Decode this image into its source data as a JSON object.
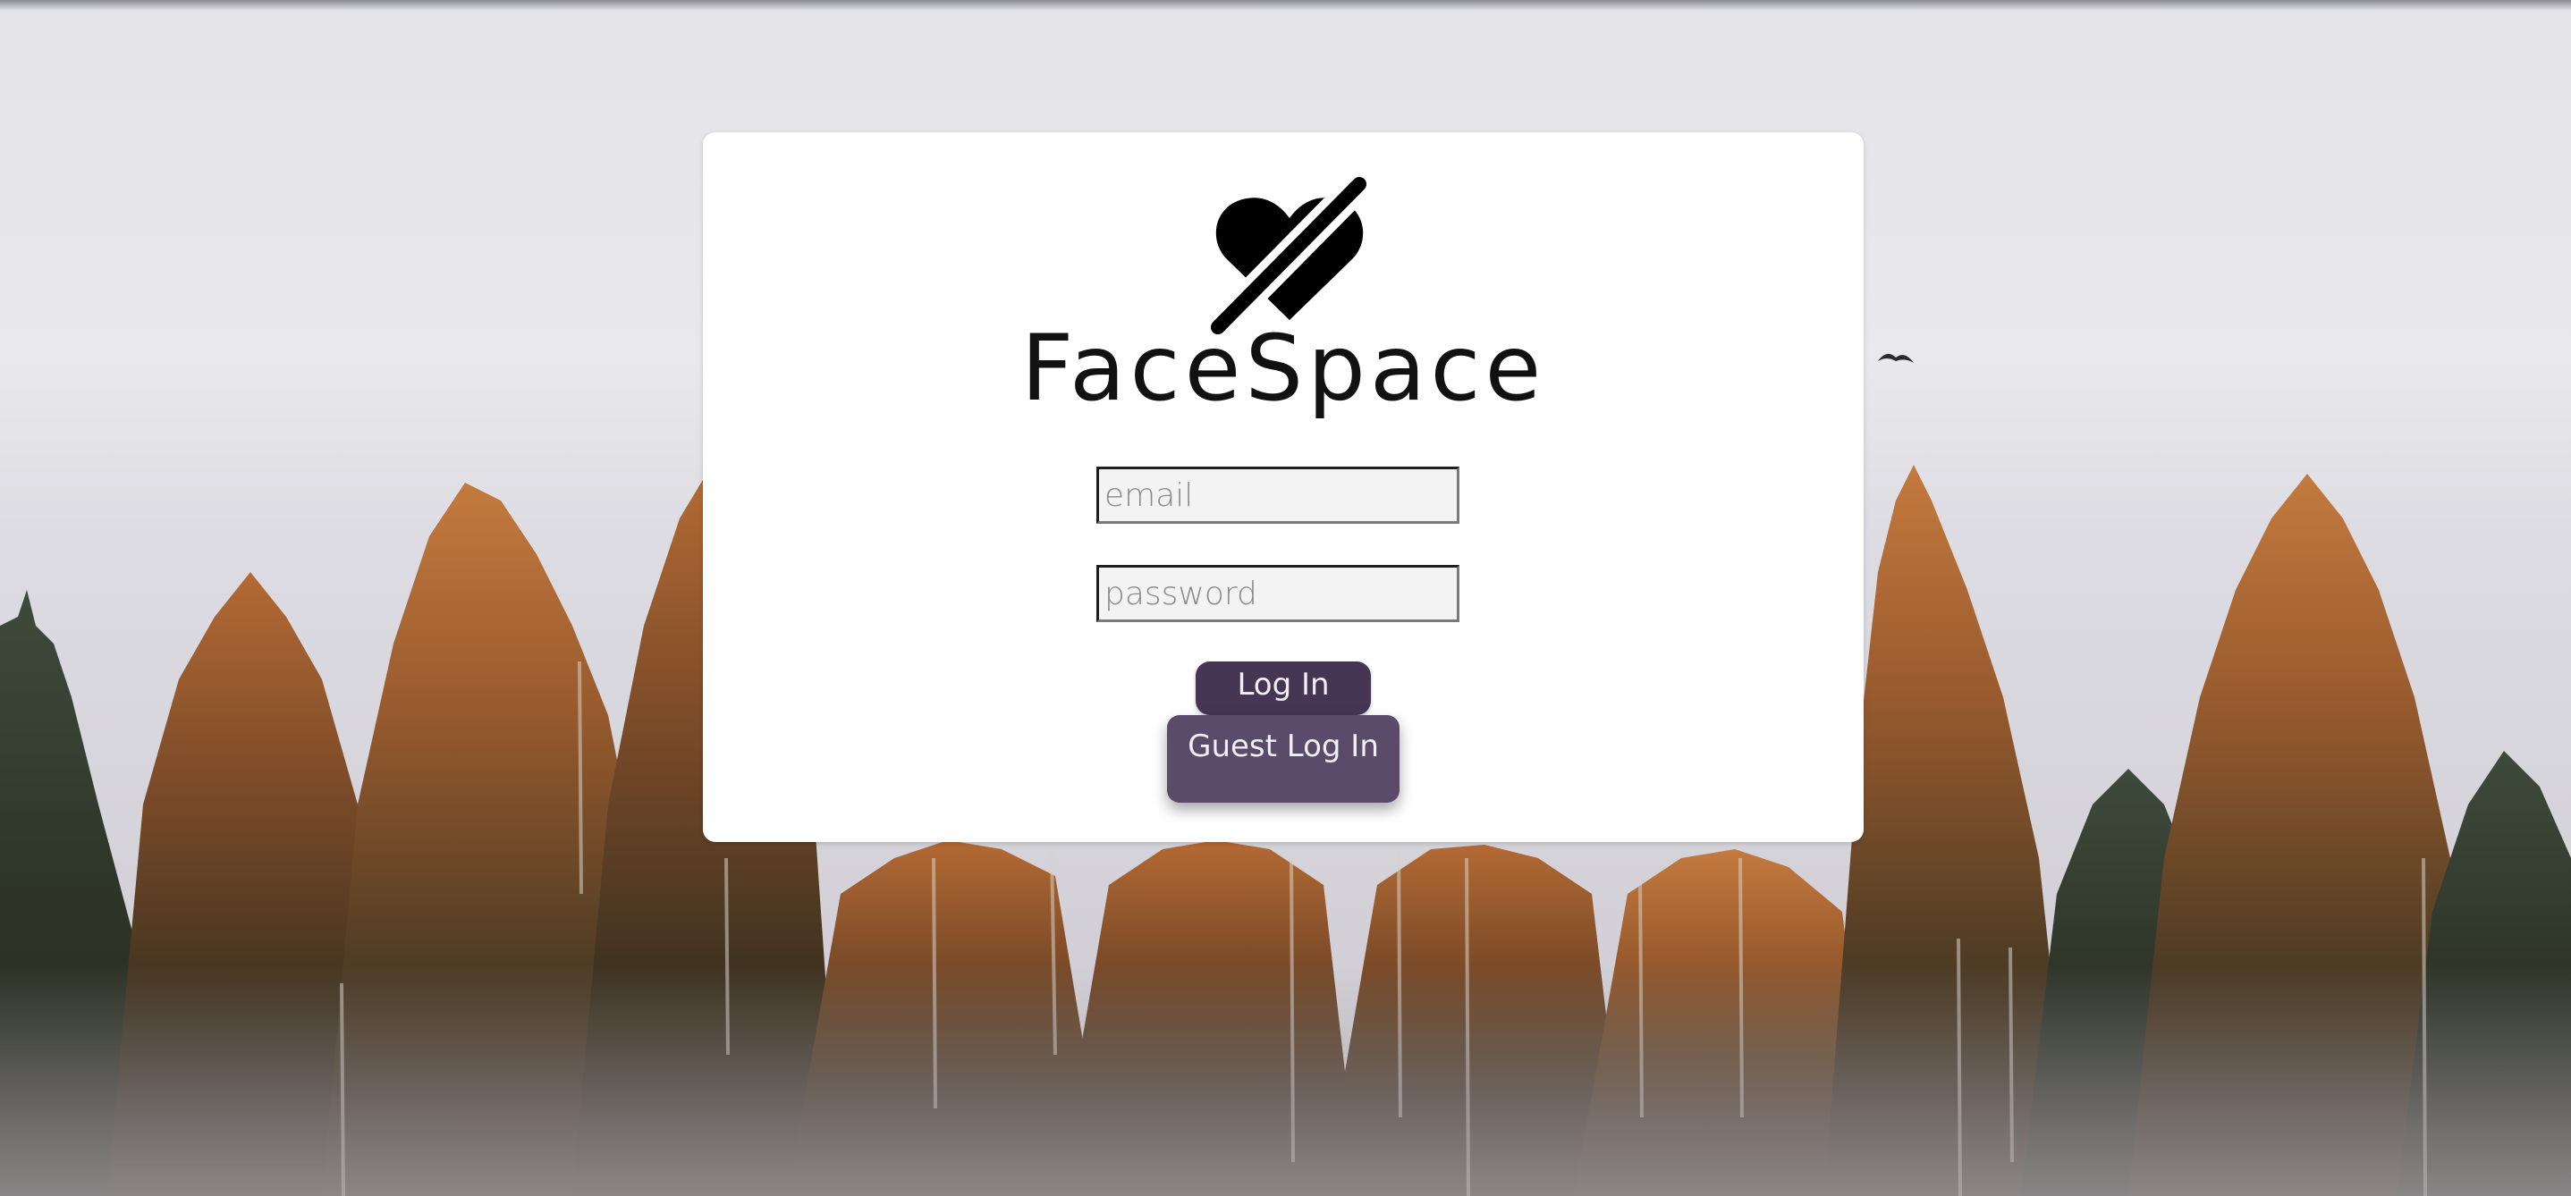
{
  "app": {
    "brand_name": "FaceSpace",
    "logo_icon": "heart-slash-icon"
  },
  "login_form": {
    "email_placeholder": "email",
    "email_value": "",
    "password_placeholder": "password",
    "password_value": "",
    "login_label": "Log In",
    "guest_login_label": "Guest Log In"
  },
  "background": {
    "image": "forest-treeline-photo",
    "decorations": [
      "bird-icon"
    ]
  },
  "colors": {
    "login_button": "#463654",
    "guest_button": "#5b4b6b",
    "card": "#ffffff",
    "input_background": "#f3f3f3"
  }
}
